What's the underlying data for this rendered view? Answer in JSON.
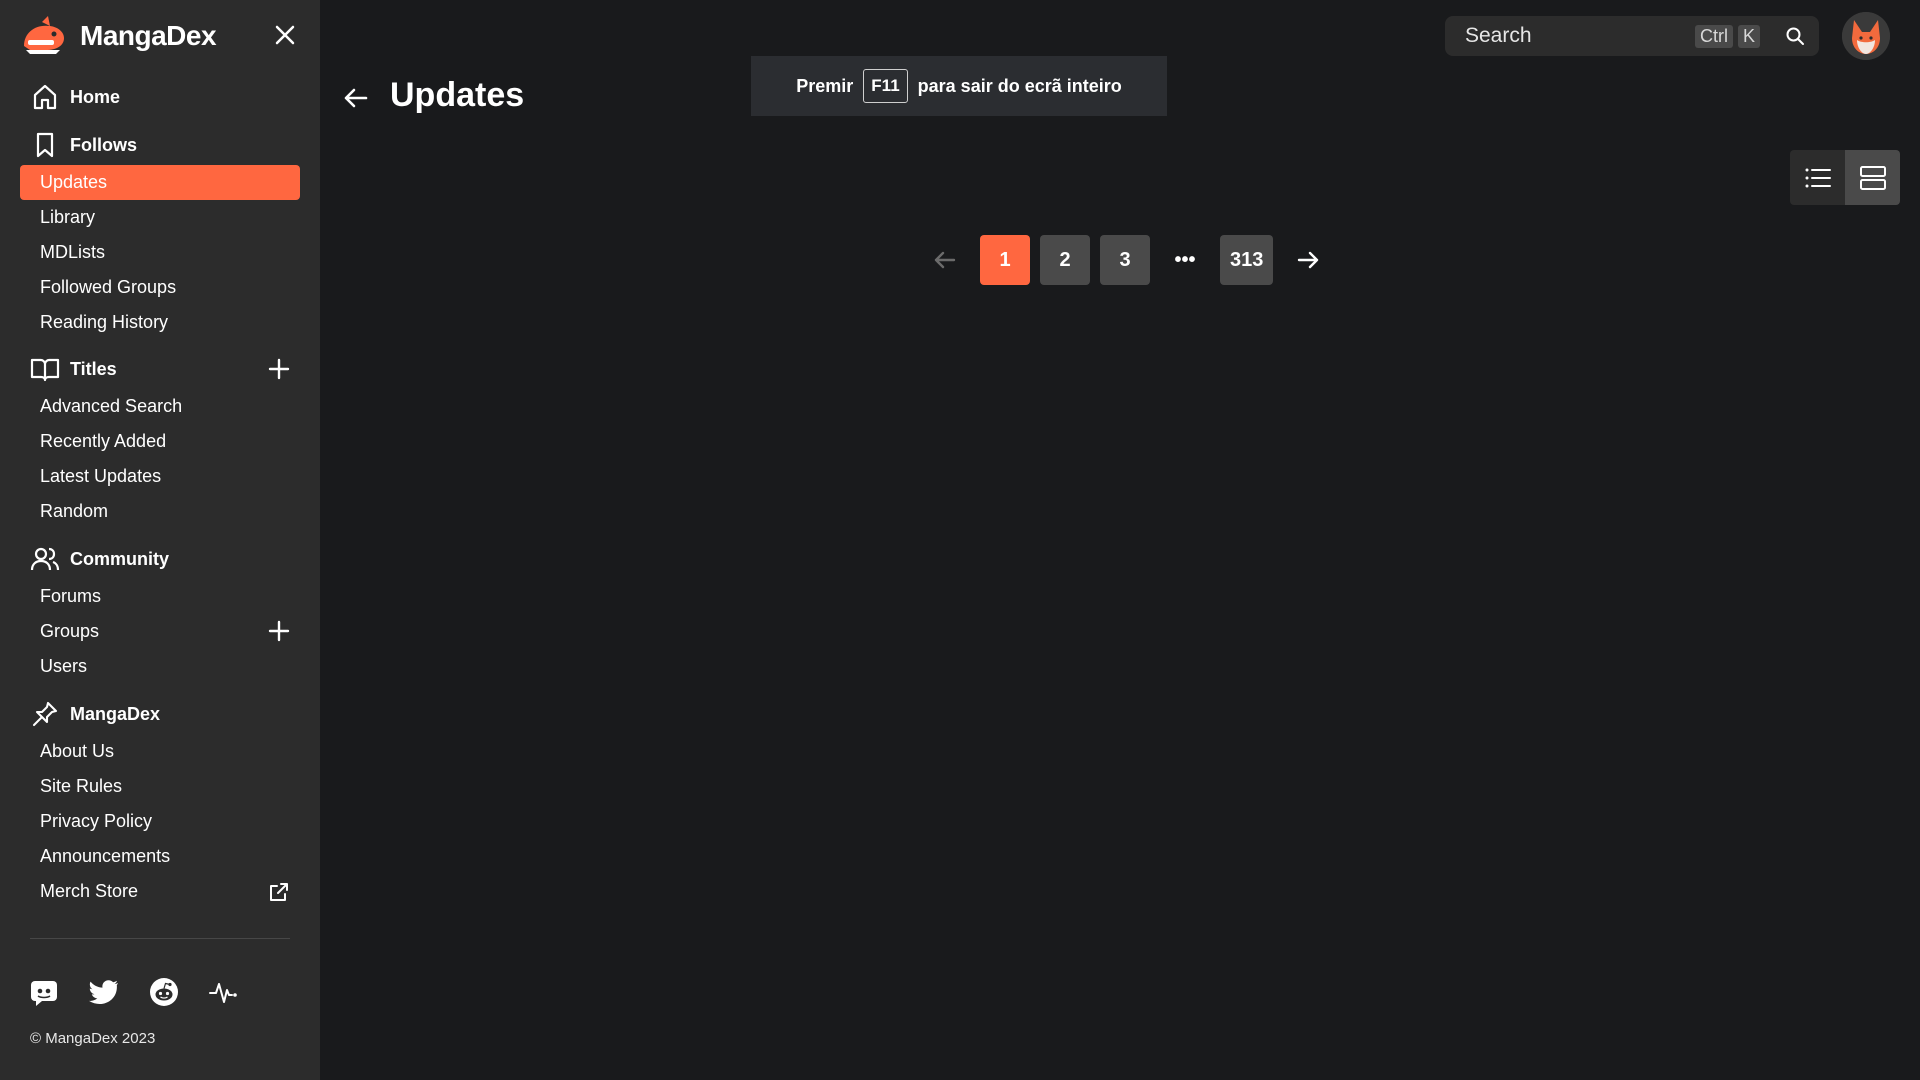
{
  "brand": {
    "name": "MangaDex"
  },
  "nav": {
    "home": "Home",
    "follows": {
      "label": "Follows",
      "items": [
        "Updates",
        "Library",
        "MDLists",
        "Followed Groups",
        "Reading History"
      ],
      "active": "Updates"
    },
    "titles": {
      "label": "Titles",
      "items": [
        "Advanced Search",
        "Recently Added",
        "Latest Updates",
        "Random"
      ]
    },
    "community": {
      "label": "Community",
      "items": [
        "Forums",
        "Groups",
        "Users"
      ]
    },
    "mangadex": {
      "label": "MangaDex",
      "items": [
        "About Us",
        "Site Rules",
        "Privacy Policy",
        "Announcements",
        "Merch Store"
      ]
    }
  },
  "footer": {
    "copyright": "© MangaDex 2023"
  },
  "page": {
    "title": "Updates"
  },
  "fullscreen_notice": {
    "before": "Premir",
    "key": "F11",
    "after": "para sair do ecrã inteiro"
  },
  "search": {
    "placeholder": "Search",
    "shortcut_mod": "Ctrl",
    "shortcut_key": "K"
  },
  "pagination": {
    "pages": [
      "1",
      "2",
      "3"
    ],
    "ellipsis": "•••",
    "last": "313",
    "current": "1"
  },
  "colors": {
    "accent": "#ff6740",
    "sidebar": "#2c2c2c",
    "background": "#191a1c"
  },
  "icons": {
    "home": "home-icon",
    "follows": "bookmark-icon",
    "titles": "book-open-icon",
    "community": "users-icon",
    "mangadex": "pin-icon",
    "close": "close-icon",
    "social": [
      "discord-icon",
      "twitter-icon",
      "reddit-icon",
      "status-icon"
    ]
  }
}
